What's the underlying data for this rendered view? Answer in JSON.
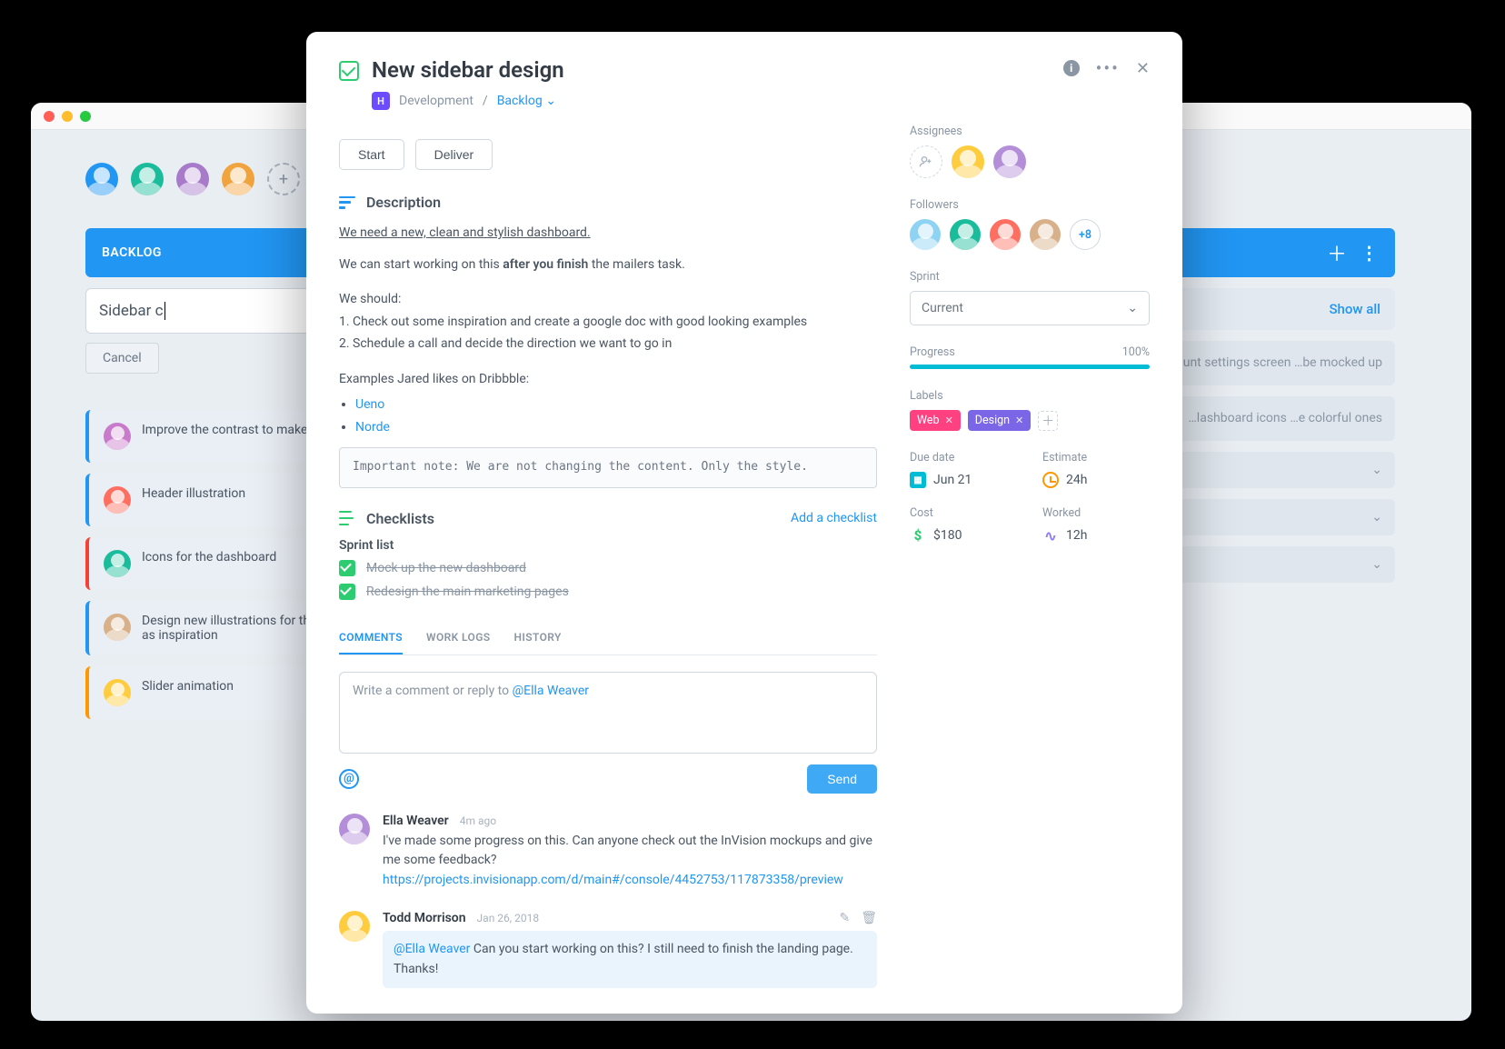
{
  "window": {
    "topbar_avatars": [
      "#2196f3",
      "#1abc9c",
      "#a77bca",
      "#f1a33e"
    ]
  },
  "board": {
    "column_left": {
      "title": "BACKLOG",
      "input_value": "Sidebar c",
      "cancel_label": "Cancel",
      "cards": [
        {
          "color": "blue",
          "avatar": "#c77bca",
          "text": "Improve the contrast to make Jared happy :D"
        },
        {
          "color": "blue",
          "avatar": "#ff6f61",
          "text": "Header illustration"
        },
        {
          "color": "red",
          "avatar": "#1abc9c",
          "text": "Icons for the dashboard"
        },
        {
          "color": "blue",
          "avatar": "#d8b089",
          "text": "Design new illustrations for the app onboarding screens. Use Slack as inspiration"
        },
        {
          "color": "orange",
          "avatar": "#ffcc3f",
          "text": "Slider animation"
        }
      ]
    },
    "column_right": {
      "show_all": "Show all",
      "truncated_cards": [
        "…unt settings screen …be mocked up",
        "…lashboard icons …e colorful ones"
      ],
      "collapsed_count": 3
    }
  },
  "task": {
    "title": "New sidebar design",
    "breadcrumb": {
      "badge": "H",
      "project": "Development",
      "list": "Backlog"
    },
    "actions": {
      "start": "Start",
      "deliver": "Deliver"
    },
    "description": {
      "heading": "Description",
      "line1": "We need a new, clean and stylish dashboard.",
      "line2_a": "We can start working on this ",
      "line2_b": "after you finish",
      "line2_c": " the mailers task.",
      "should_intro": "We should:",
      "items": [
        "1. Check out some inspiration and create a google doc with good looking examples",
        "2. Schedule a call and decide the direction we want to go in"
      ],
      "examples_intro": "Examples Jared likes on Dribbble:",
      "examples": [
        "Ueno",
        "Norde"
      ],
      "note": "Important note: We are not changing the content. Only the style."
    },
    "checklists": {
      "heading": "Checklists",
      "add_label": "Add a checklist",
      "list_title": "Sprint list",
      "items": [
        {
          "done": true,
          "text": "Mock up the new dashboard"
        },
        {
          "done": true,
          "text": "Redesign the main marketing pages"
        }
      ]
    },
    "tabs": {
      "comments": "COMMENTS",
      "worklogs": "WORK LOGS",
      "history": "HISTORY"
    },
    "comment_box": {
      "placeholder_a": "Write a comment or reply to ",
      "placeholder_b": "@Ella Weaver",
      "send": "Send"
    },
    "comments": [
      {
        "avatar": "#b48ed9",
        "author": "Ella Weaver",
        "time": "4m ago",
        "text": "I've made some progress on this. Can anyone check out the InVision mockups and give me some feedback?",
        "link": "https://projects.invisionapp.com/d/main#/console/4452753/117873358/preview",
        "highlight": false,
        "actions": false
      },
      {
        "avatar": "#ffcc3f",
        "author": "Todd Morrison",
        "time": "Jan 26, 2018",
        "mention": "@Ella Weaver",
        "text": " Can you start working on this? I still need to finish the landing page. Thanks!",
        "highlight": true,
        "actions": true
      }
    ]
  },
  "sidebar": {
    "assignees": {
      "label": "Assignees",
      "avatars": [
        "#ffcc3f",
        "#b48ed9"
      ]
    },
    "followers": {
      "label": "Followers",
      "avatars": [
        "#8fd3f4",
        "#1abc9c",
        "#ff6f61",
        "#d8b089"
      ],
      "more": "+8"
    },
    "sprint": {
      "label": "Sprint",
      "value": "Current"
    },
    "progress": {
      "label": "Progress",
      "value": "100%",
      "percent": 100
    },
    "labels": {
      "label": "Labels",
      "items": [
        {
          "text": "Web",
          "color": "pink"
        },
        {
          "text": "Design",
          "color": "purple"
        }
      ]
    },
    "due": {
      "label": "Due date",
      "value": "Jun 21"
    },
    "estimate": {
      "label": "Estimate",
      "value": "24h"
    },
    "cost": {
      "label": "Cost",
      "value": "$180"
    },
    "worked": {
      "label": "Worked",
      "value": "12h"
    }
  }
}
